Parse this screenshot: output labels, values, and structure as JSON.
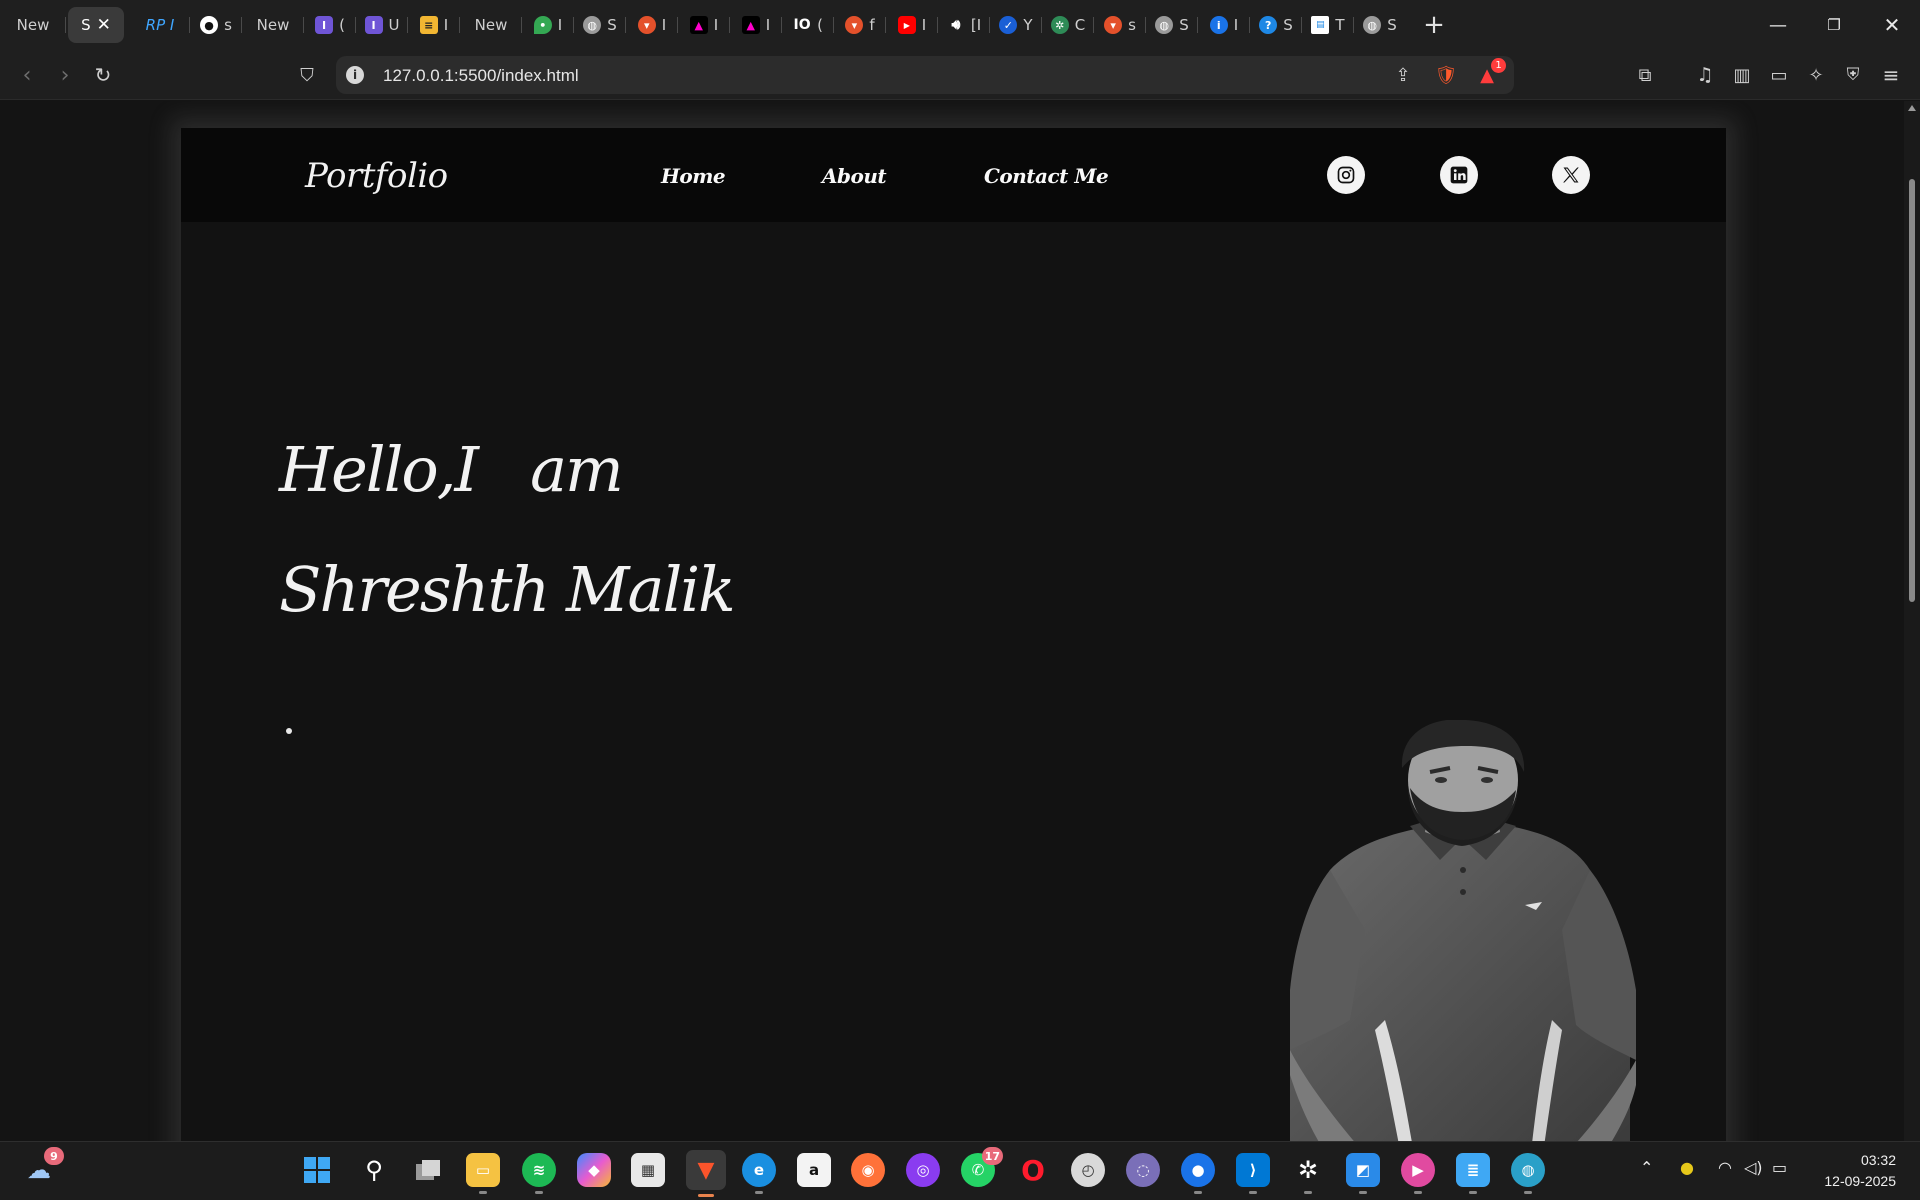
{
  "browser": {
    "tabs": [
      {
        "label": "New",
        "favicon": "none",
        "color": ""
      },
      {
        "label": "S",
        "favicon": "none",
        "color": "",
        "active": true
      },
      {
        "label": "RP I",
        "favicon": "rp-icon",
        "color": "#3fa6ff"
      },
      {
        "label": "s",
        "favicon": "github-icon",
        "color": "#ffffff"
      },
      {
        "label": "New",
        "favicon": "none",
        "color": ""
      },
      {
        "label": "(",
        "favicon": "app-icon",
        "color": "#6f55d6"
      },
      {
        "label": "U",
        "favicon": "app-icon",
        "color": "#6f55d6"
      },
      {
        "label": "I",
        "favicon": "stack-icon",
        "color": "#f2b632"
      },
      {
        "label": "New",
        "favicon": "none",
        "color": ""
      },
      {
        "label": "I",
        "favicon": "maps-icon",
        "color": "#34a853"
      },
      {
        "label": "S",
        "favicon": "globe-icon",
        "color": "#9a9a9a"
      },
      {
        "label": "I",
        "favicon": "brave-icon",
        "color": "#e4512b"
      },
      {
        "label": "I",
        "favicon": "triangle-icon",
        "color": "#000000"
      },
      {
        "label": "I",
        "favicon": "triangle-icon",
        "color": "#000000"
      },
      {
        "label": "(",
        "favicon": "io-icon",
        "color": "#1f1f1f"
      },
      {
        "label": "f",
        "favicon": "brave-icon",
        "color": "#e4512b"
      },
      {
        "label": "I",
        "favicon": "youtube-icon",
        "color": "#ff0000"
      },
      {
        "label": "[I",
        "favicon": "speaker-icon",
        "color": "#1f1f1f"
      },
      {
        "label": "Y",
        "favicon": "check-icon",
        "color": "#1a5fd6"
      },
      {
        "label": "C",
        "favicon": "gear-icon",
        "color": "#2e8b57"
      },
      {
        "label": "s",
        "favicon": "brave-icon",
        "color": "#e4512b"
      },
      {
        "label": "S",
        "favicon": "globe-icon",
        "color": "#9a9a9a"
      },
      {
        "label": "I",
        "favicon": "info-icon",
        "color": "#1a73e8"
      },
      {
        "label": "S",
        "favicon": "info-icon",
        "color": "#1e88e5"
      },
      {
        "label": "T",
        "favicon": "doc-icon",
        "color": "#ffffff"
      },
      {
        "label": "S",
        "favicon": "globe-icon",
        "color": "#9a9a9a"
      }
    ],
    "new_tab": "+",
    "url": "127.0.0.1:5500/index.html",
    "alert_count": "1"
  },
  "site": {
    "brand": "Portfolio",
    "nav": [
      "Home",
      "About",
      "Contact Me"
    ],
    "socials": [
      "instagram-icon",
      "linkedin-icon",
      "x-icon"
    ],
    "hero_line1": "Hello,I   am",
    "hero_line2": "Shreshth Malik"
  },
  "taskbar": {
    "weather_badge": "9",
    "whatsapp_badge": "17",
    "time": "03:32",
    "date": "12-09-2025"
  }
}
